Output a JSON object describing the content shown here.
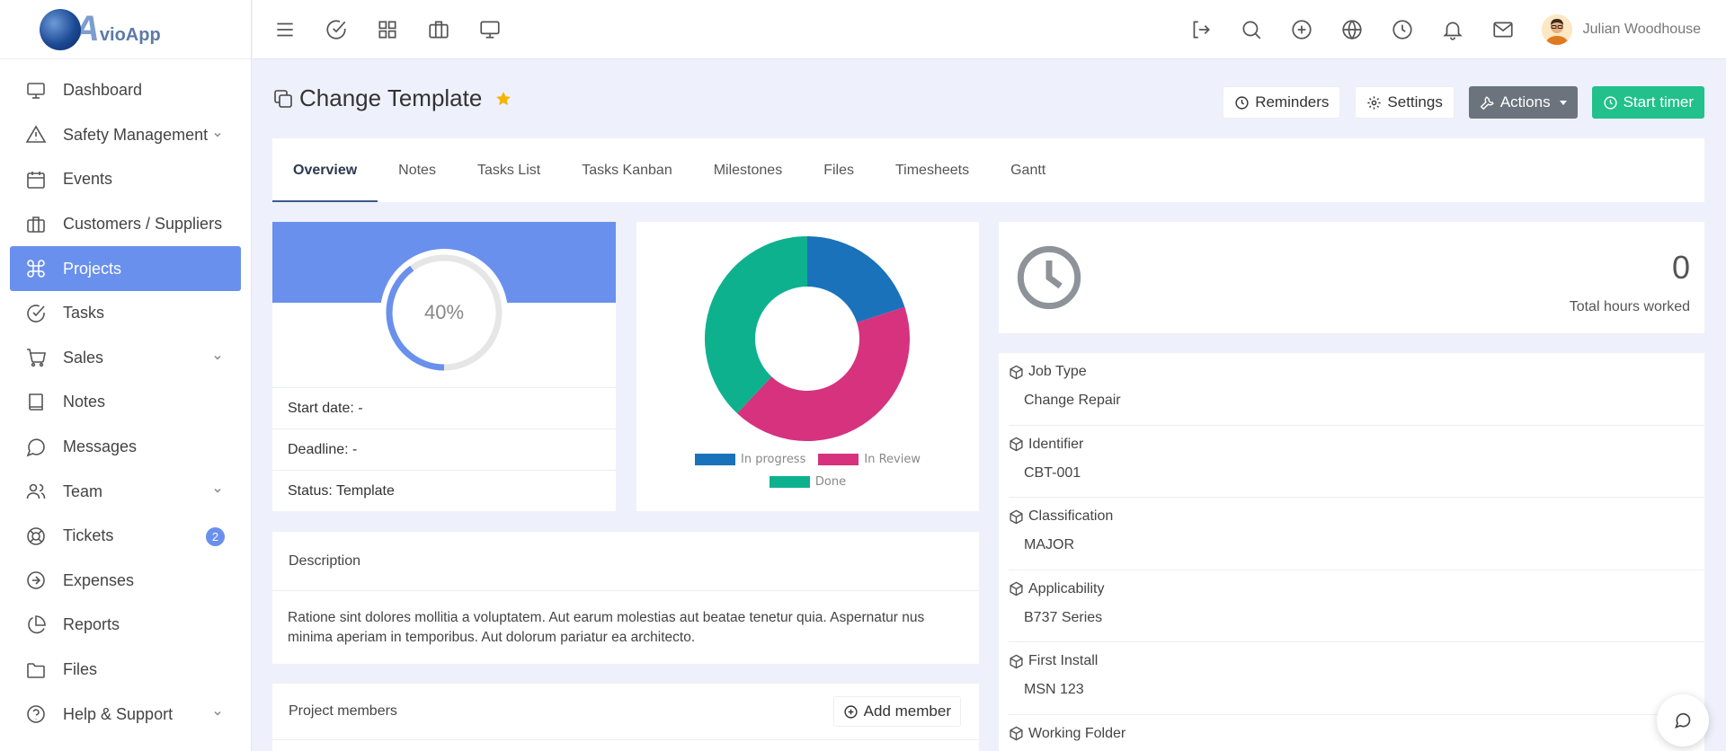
{
  "app": {
    "logo_big": "A",
    "logo_small": "vioApp"
  },
  "user": {
    "name": "Julian Woodhouse"
  },
  "sidebar": {
    "items": [
      {
        "label": "Dashboard",
        "icon": "monitor-icon"
      },
      {
        "label": "Safety Management",
        "icon": "warning-icon",
        "expandable": true
      },
      {
        "label": "Events",
        "icon": "calendar-icon"
      },
      {
        "label": "Customers / Suppliers",
        "icon": "briefcase-icon"
      },
      {
        "label": "Projects",
        "icon": "command-icon",
        "active": true
      },
      {
        "label": "Tasks",
        "icon": "check-circle-icon"
      },
      {
        "label": "Sales",
        "icon": "cart-icon",
        "expandable": true
      },
      {
        "label": "Notes",
        "icon": "book-icon"
      },
      {
        "label": "Messages",
        "icon": "chat-icon"
      },
      {
        "label": "Team",
        "icon": "users-icon",
        "expandable": true
      },
      {
        "label": "Tickets",
        "icon": "lifebuoy-icon",
        "badge": "2"
      },
      {
        "label": "Expenses",
        "icon": "arrow-circle-icon"
      },
      {
        "label": "Reports",
        "icon": "pie-chart-icon"
      },
      {
        "label": "Files",
        "icon": "folder-icon"
      },
      {
        "label": "Help & Support",
        "icon": "help-circle-icon",
        "expandable": true
      }
    ]
  },
  "page": {
    "title": "Change Template",
    "buttons": {
      "reminders": "Reminders",
      "settings": "Settings",
      "actions": "Actions",
      "start_timer": "Start timer"
    }
  },
  "tabs": [
    "Overview",
    "Notes",
    "Tasks List",
    "Tasks Kanban",
    "Milestones",
    "Files",
    "Timesheets",
    "Gantt"
  ],
  "progress": {
    "percent_label": "40%",
    "percent": 40,
    "start_date": "Start date: -",
    "deadline": "Deadline: -",
    "status": "Status: Template"
  },
  "chart_data": {
    "type": "pie",
    "categories": [
      "In progress",
      "In Review",
      "Done"
    ],
    "values": [
      20,
      42,
      38
    ],
    "colors": [
      "#1a72bb",
      "#d6327e",
      "#0db18e"
    ],
    "legend": "bottom"
  },
  "hours": {
    "value": "0",
    "label": "Total hours worked"
  },
  "info": [
    {
      "key": "Job Type",
      "value": "Change Repair"
    },
    {
      "key": "Identifier",
      "value": "CBT-001"
    },
    {
      "key": "Classification",
      "value": "MAJOR"
    },
    {
      "key": "Applicability",
      "value": "B737 Series"
    },
    {
      "key": "First Install",
      "value": "MSN 123"
    },
    {
      "key": "Working Folder",
      "value": ""
    }
  ],
  "description": {
    "title": "Description",
    "text": "Ratione sint dolores mollitia a voluptatem. Aut earum molestias aut beatae tenetur quia. Aspernatur nus minima aperiam in temporibus. Aut dolorum pariatur ea architecto."
  },
  "members": {
    "title": "Project members",
    "add_label": "Add member"
  },
  "colors": {
    "accent": "#6a90ee",
    "success": "#22c08a",
    "dark_button": "#6b747d"
  }
}
